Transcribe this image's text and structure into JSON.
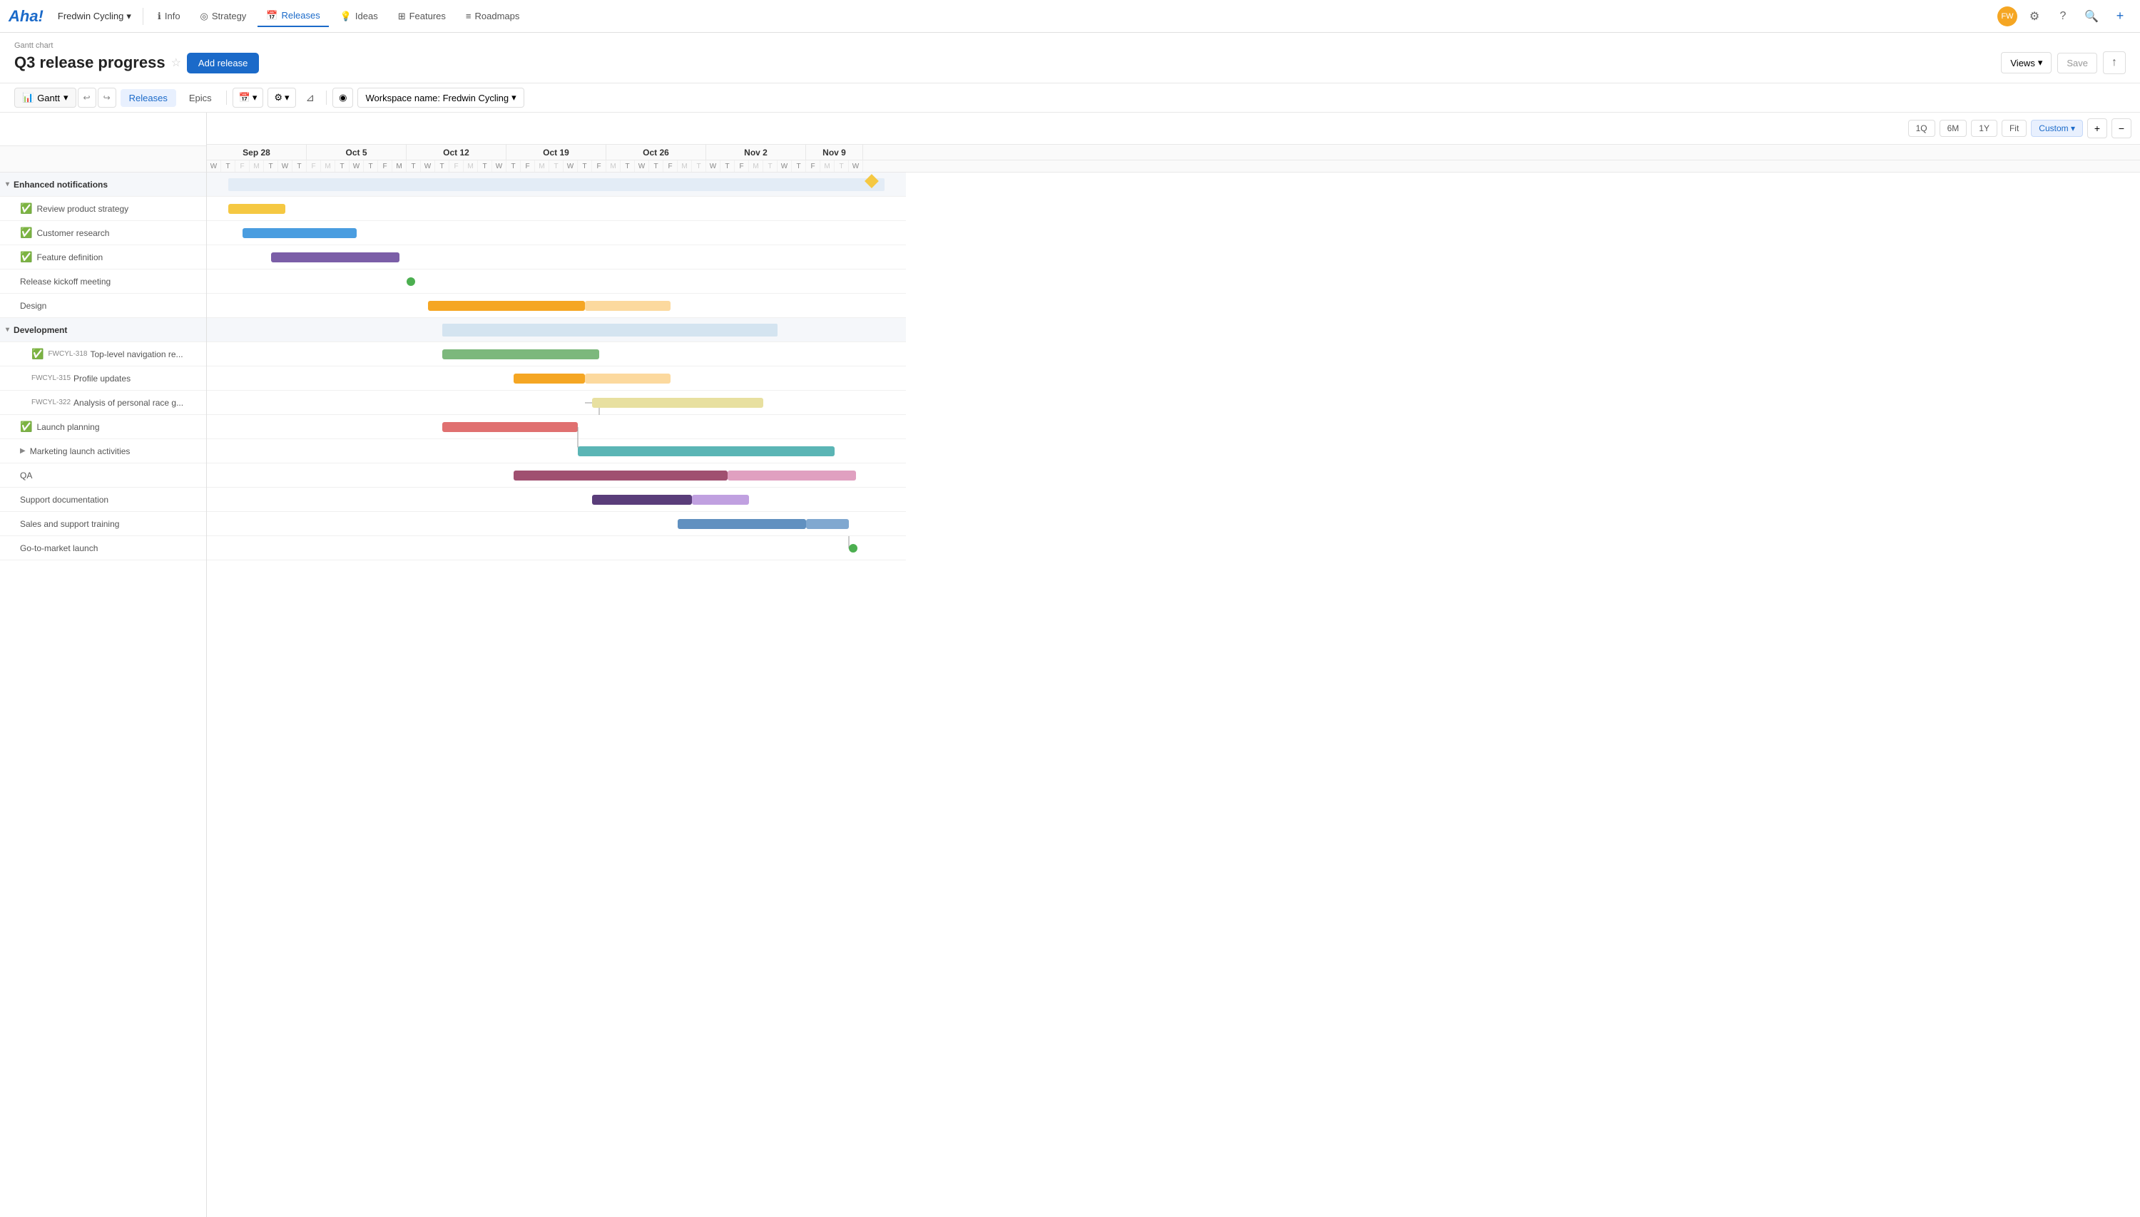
{
  "app": {
    "logo": "Aha!",
    "workspace": "Fredwin Cycling",
    "nav_items": [
      {
        "label": "Info",
        "icon": "info"
      },
      {
        "label": "Strategy",
        "icon": "strategy"
      },
      {
        "label": "Releases",
        "icon": "calendar",
        "active": true
      },
      {
        "label": "Ideas",
        "icon": "lightbulb"
      },
      {
        "label": "Features",
        "icon": "grid"
      },
      {
        "label": "Roadmaps",
        "icon": "roadmap"
      }
    ]
  },
  "header": {
    "gantt_label": "Gantt chart",
    "title": "Q3 release progress",
    "add_release_label": "Add release",
    "views_label": "Views",
    "save_label": "Save"
  },
  "toolbar": {
    "gantt_label": "Gantt",
    "releases_label": "Releases",
    "epics_label": "Epics",
    "workspace_label": "Workspace name: Fredwin Cycling"
  },
  "gantt": {
    "time_controls": [
      "1Q",
      "6M",
      "1Y",
      "Fit",
      "Custom"
    ],
    "active_time": "Custom",
    "months": [
      {
        "label": "Sep 28",
        "cols": 7
      },
      {
        "label": "Oct 5",
        "cols": 7
      },
      {
        "label": "Oct 12",
        "cols": 7
      },
      {
        "label": "Oct 19",
        "cols": 7
      },
      {
        "label": "Oct 26",
        "cols": 7
      },
      {
        "label": "Nov 2",
        "cols": 7
      },
      {
        "label": "Nov 9",
        "cols": 4
      }
    ]
  },
  "rows": [
    {
      "id": "enhanced-notifications",
      "label": "Enhanced notifications",
      "type": "group",
      "collapsed": false
    },
    {
      "id": "review-product-strategy",
      "label": "Review product strategy",
      "type": "sub",
      "check": true
    },
    {
      "id": "customer-research",
      "label": "Customer research",
      "type": "sub",
      "check": true
    },
    {
      "id": "feature-definition",
      "label": "Feature definition",
      "type": "sub",
      "check": true
    },
    {
      "id": "release-kickoff-meeting",
      "label": "Release kickoff meeting",
      "type": "sub",
      "check": false
    },
    {
      "id": "design",
      "label": "Design",
      "type": "sub",
      "check": false
    },
    {
      "id": "development",
      "label": "Development",
      "type": "group",
      "collapsed": false
    },
    {
      "id": "fwcyl-318",
      "label": "Top-level navigation re...",
      "featureId": "FWCYL-318",
      "type": "deep",
      "check": true
    },
    {
      "id": "fwcyl-315",
      "label": "Profile updates",
      "featureId": "FWCYL-315",
      "type": "deep",
      "check": false
    },
    {
      "id": "fwcyl-322",
      "label": "Analysis of personal race g...",
      "featureId": "FWCYL-322",
      "type": "deep",
      "check": false
    },
    {
      "id": "launch-planning",
      "label": "Launch planning",
      "type": "sub",
      "check": true
    },
    {
      "id": "marketing-launch-activities",
      "label": "Marketing launch activities",
      "type": "sub",
      "check": false,
      "collapsed": true
    },
    {
      "id": "qa",
      "label": "QA",
      "type": "sub",
      "check": false
    },
    {
      "id": "support-documentation",
      "label": "Support documentation",
      "type": "sub",
      "check": false
    },
    {
      "id": "sales-and-support-training",
      "label": "Sales and support training",
      "type": "sub",
      "check": false
    },
    {
      "id": "go-to-market-launch",
      "label": "Go-to-market launch",
      "type": "sub",
      "check": false
    }
  ]
}
